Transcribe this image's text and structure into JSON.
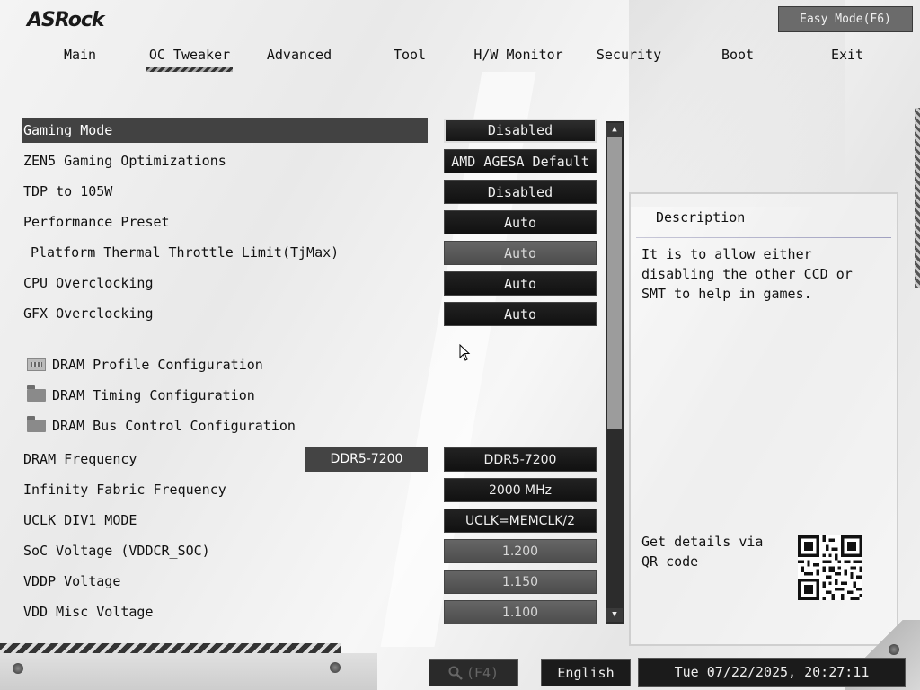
{
  "brand": "ASRock",
  "easy_mode_label": "Easy Mode(F6)",
  "tabs": [
    {
      "label": "Main"
    },
    {
      "label": "OC Tweaker"
    },
    {
      "label": "Advanced"
    },
    {
      "label": "Tool"
    },
    {
      "label": "H/W Monitor"
    },
    {
      "label": "Security"
    },
    {
      "label": "Boot"
    },
    {
      "label": "Exit"
    }
  ],
  "active_tab": "OC Tweaker",
  "settings": [
    {
      "label": "Gaming Mode",
      "value": "Disabled"
    },
    {
      "label": "ZEN5 Gaming Optimizations",
      "value": "AMD AGESA Default"
    },
    {
      "label": "TDP to 105W",
      "value": "Disabled"
    },
    {
      "label": "Performance Preset",
      "value": "Auto"
    },
    {
      "label": "Platform Thermal Throttle Limit(TjMax)",
      "value": "Auto"
    },
    {
      "label": "CPU Overclocking",
      "value": "Auto"
    },
    {
      "label": "GFX Overclocking",
      "value": "Auto"
    },
    {
      "label": "DRAM Profile Configuration"
    },
    {
      "label": "DRAM Timing Configuration"
    },
    {
      "label": "DRAM Bus Control Configuration"
    },
    {
      "label": "DRAM Frequency",
      "current": "DDR5-7200",
      "value": "DDR5-7200"
    },
    {
      "label": "Infinity Fabric Frequency",
      "value": "2000 MHz"
    },
    {
      "label": "UCLK DIV1 MODE",
      "value": "UCLK=MEMCLK/2"
    },
    {
      "label": "SoC Voltage (VDDCR_SOC)",
      "value": "1.200"
    },
    {
      "label": "VDDP Voltage",
      "value": "1.150"
    },
    {
      "label": "VDD Misc Voltage",
      "value": "1.100"
    }
  ],
  "description": {
    "title": "Description",
    "text": "It is to allow either disabling the other CCD or SMT to help in games.",
    "qr_text": "Get details via QR code"
  },
  "footer": {
    "search_label": "(F4)",
    "language": "English",
    "datetime": "Tue 07/22/2025, 20:27:11"
  },
  "colors": {
    "selected_row": "#424242",
    "value_box": "#1a1a1a",
    "value_box_disabled": "#5a5a5a",
    "background": "#eeeeee"
  }
}
